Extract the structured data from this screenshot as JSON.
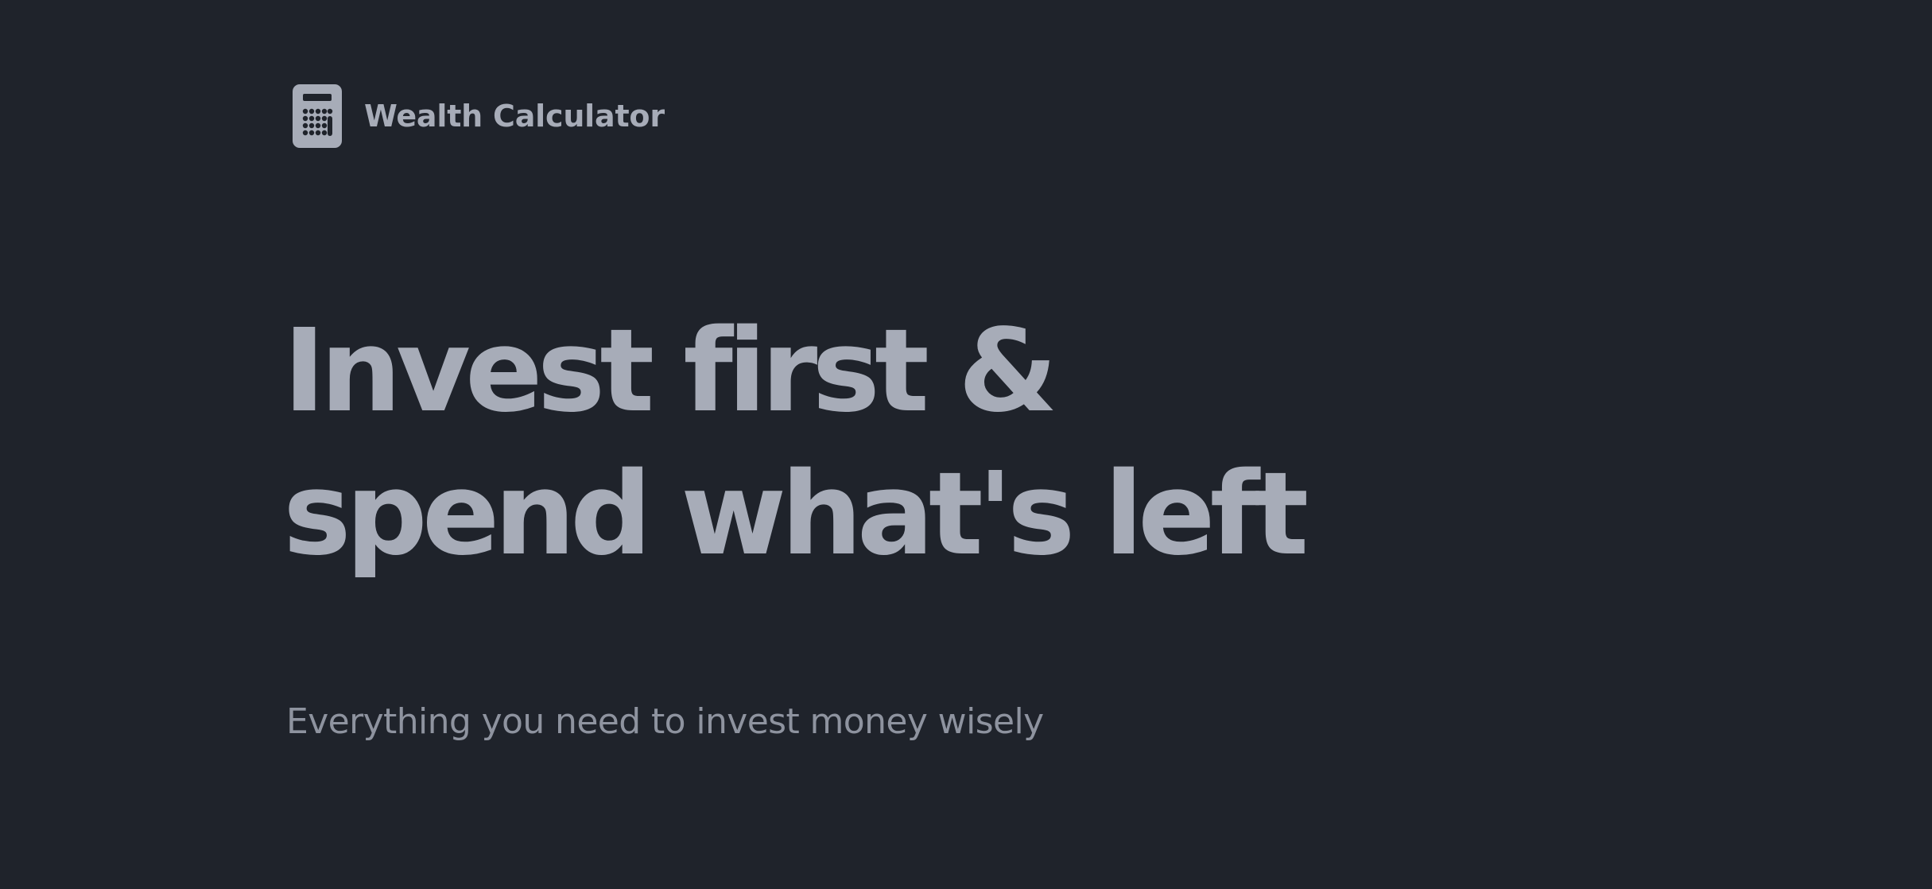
{
  "brand": {
    "icon": "calculator-icon",
    "name": "Wealth Calculator"
  },
  "hero": {
    "title_line1": "Invest first &",
    "title_line2": "spend what's left",
    "subtitle": "Everything you need to invest money wisely"
  },
  "colors": {
    "background": "#1f232b",
    "text_primary": "#a7acb8",
    "text_secondary": "#8e939f"
  }
}
